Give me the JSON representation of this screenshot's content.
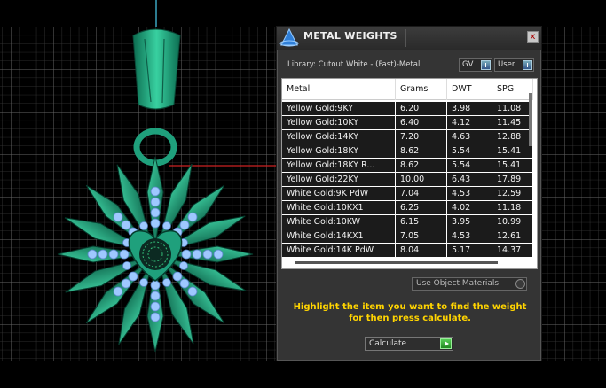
{
  "dialog": {
    "title": "METAL WEIGHTS",
    "close_label": "x",
    "library_label": "Library: Cutout White - (Fast)-Metal",
    "toggle_gv": "GV",
    "toggle_user": "User"
  },
  "table": {
    "headers": [
      "Metal",
      "Grams",
      "DWT",
      "SPG"
    ],
    "rows": [
      [
        "Yellow Gold:9KY",
        "6.20",
        "3.98",
        "11.08"
      ],
      [
        "Yellow Gold:10KY",
        "6.40",
        "4.12",
        "11.45"
      ],
      [
        "Yellow Gold:14KY",
        "7.20",
        "4.63",
        "12.88"
      ],
      [
        "Yellow Gold:18KY",
        "8.62",
        "5.54",
        "15.41"
      ],
      [
        "Yellow Gold:18KY R...",
        "8.62",
        "5.54",
        "15.41"
      ],
      [
        "Yellow Gold:22KY",
        "10.00",
        "6.43",
        "17.89"
      ],
      [
        "White Gold:9K PdW",
        "7.04",
        "4.53",
        "12.59"
      ],
      [
        "White Gold:10KX1",
        "6.25",
        "4.02",
        "11.18"
      ],
      [
        "White Gold:10KW",
        "6.15",
        "3.95",
        "10.99"
      ],
      [
        "White Gold:14KX1",
        "7.05",
        "4.53",
        "12.61"
      ],
      [
        "White Gold:14K PdW",
        "8.04",
        "5.17",
        "14.37"
      ]
    ]
  },
  "controls": {
    "use_object_materials": "Use Object Materials",
    "instruction": "Highlight the item you want to find the weight for then press calculate.",
    "calculate_label": "Calculate"
  },
  "colors": {
    "accent_yellow": "#ffd400",
    "jewelry_green": "#1a9a78",
    "gem_blue": "#9ec8ff",
    "grid": "#5a5a5a"
  }
}
